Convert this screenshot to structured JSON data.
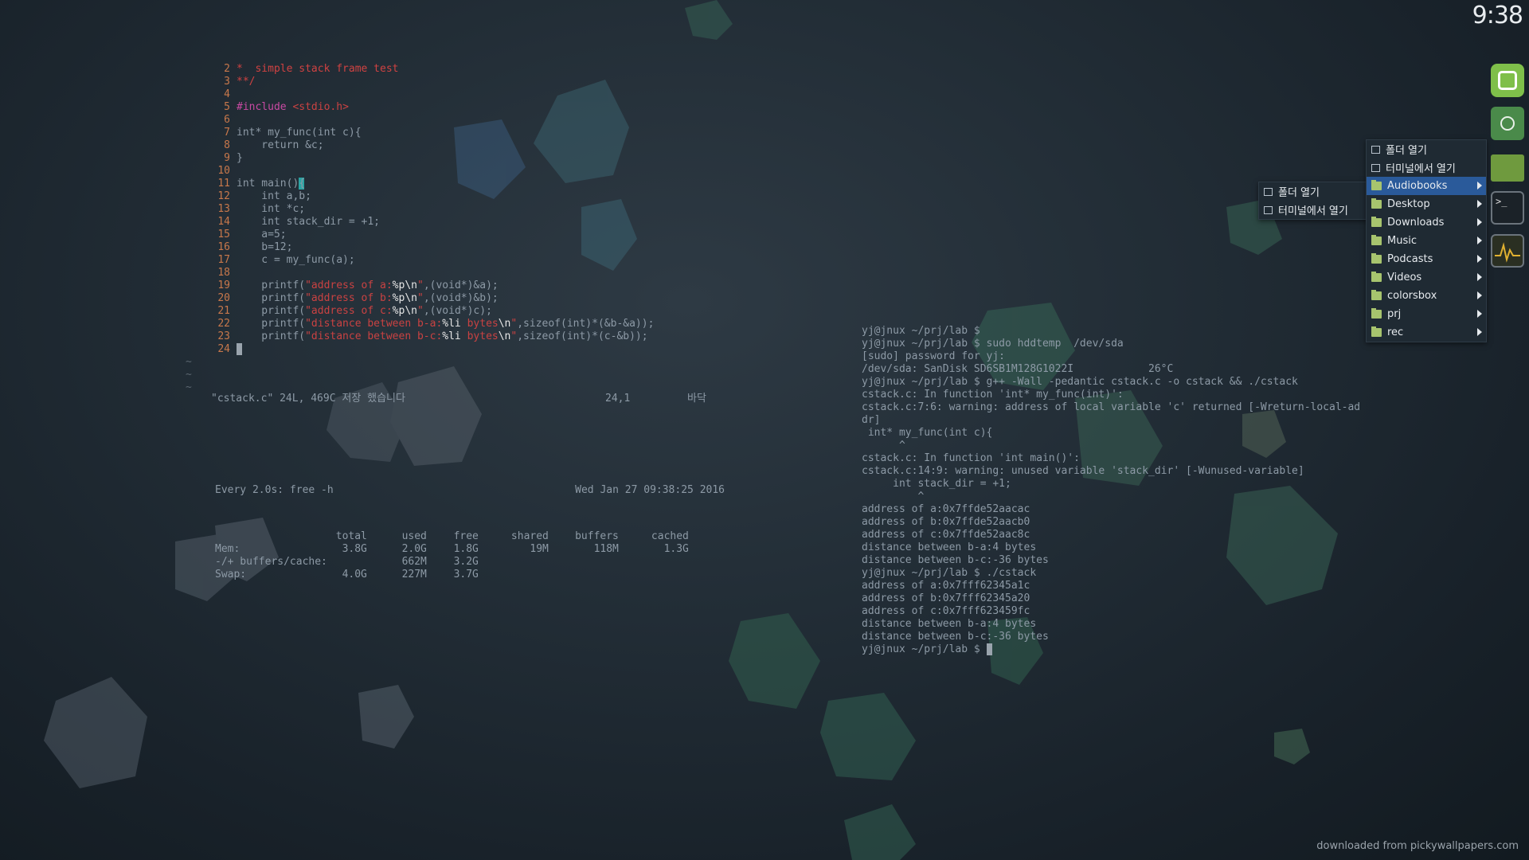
{
  "clock": "9:38",
  "vim": {
    "lines": [
      {
        "n": "2",
        "parts": [
          {
            "t": "*  simple stack frame test",
            "c": "red"
          }
        ]
      },
      {
        "n": "3",
        "parts": [
          {
            "t": "**/",
            "c": "red"
          }
        ]
      },
      {
        "n": "4",
        "parts": [
          {
            "t": "",
            "c": ""
          }
        ]
      },
      {
        "n": "5",
        "parts": [
          {
            "t": "#include ",
            "c": "pink"
          },
          {
            "t": "<stdio.h>",
            "c": "str"
          }
        ]
      },
      {
        "n": "6",
        "parts": [
          {
            "t": "",
            "c": ""
          }
        ]
      },
      {
        "n": "7",
        "parts": [
          {
            "t": "int* my_func(int c){",
            "c": ""
          }
        ]
      },
      {
        "n": "8",
        "parts": [
          {
            "t": "    return &c;",
            "c": ""
          }
        ]
      },
      {
        "n": "9",
        "parts": [
          {
            "t": "}",
            "c": ""
          }
        ]
      },
      {
        "n": "10",
        "parts": [
          {
            "t": "",
            "c": ""
          }
        ]
      },
      {
        "n": "11",
        "parts": [
          {
            "t": "int main()",
            "c": ""
          },
          {
            "t": "{",
            "c": "cursor"
          }
        ]
      },
      {
        "n": "12",
        "parts": [
          {
            "t": "    int a,b;",
            "c": ""
          }
        ]
      },
      {
        "n": "13",
        "parts": [
          {
            "t": "    int *c;",
            "c": ""
          }
        ]
      },
      {
        "n": "14",
        "parts": [
          {
            "t": "    int stack_dir = +1;",
            "c": ""
          }
        ]
      },
      {
        "n": "15",
        "parts": [
          {
            "t": "    a=5;",
            "c": ""
          }
        ]
      },
      {
        "n": "16",
        "parts": [
          {
            "t": "    b=12;",
            "c": ""
          }
        ]
      },
      {
        "n": "17",
        "parts": [
          {
            "t": "    c = my_func(a);",
            "c": ""
          }
        ]
      },
      {
        "n": "18",
        "parts": [
          {
            "t": "",
            "c": ""
          }
        ]
      },
      {
        "n": "19",
        "parts": [
          {
            "t": "    printf(",
            "c": ""
          },
          {
            "t": "\"address of a:",
            "c": "str"
          },
          {
            "t": "%p\\n",
            "c": "fmt"
          },
          {
            "t": "\"",
            "c": "str"
          },
          {
            "t": ",(void*)&a);",
            "c": ""
          }
        ]
      },
      {
        "n": "20",
        "parts": [
          {
            "t": "    printf(",
            "c": ""
          },
          {
            "t": "\"address of b:",
            "c": "str"
          },
          {
            "t": "%p\\n",
            "c": "fmt"
          },
          {
            "t": "\"",
            "c": "str"
          },
          {
            "t": ",(void*)&b);",
            "c": ""
          }
        ]
      },
      {
        "n": "21",
        "parts": [
          {
            "t": "    printf(",
            "c": ""
          },
          {
            "t": "\"address of c:",
            "c": "str"
          },
          {
            "t": "%p\\n",
            "c": "fmt"
          },
          {
            "t": "\"",
            "c": "str"
          },
          {
            "t": ",(void*)c);",
            "c": ""
          }
        ]
      },
      {
        "n": "22",
        "parts": [
          {
            "t": "    printf(",
            "c": ""
          },
          {
            "t": "\"distance between b-a:",
            "c": "str"
          },
          {
            "t": "%li ",
            "c": "fmt"
          },
          {
            "t": "bytes",
            "c": "str"
          },
          {
            "t": "\\n",
            "c": "fmt"
          },
          {
            "t": "\"",
            "c": "str"
          },
          {
            "t": ",sizeof(int)*(&b-&a));",
            "c": ""
          }
        ]
      },
      {
        "n": "23",
        "parts": [
          {
            "t": "    printf(",
            "c": ""
          },
          {
            "t": "\"distance between b-c:",
            "c": "str"
          },
          {
            "t": "%li ",
            "c": "fmt"
          },
          {
            "t": "bytes",
            "c": "str"
          },
          {
            "t": "\\n",
            "c": "fmt"
          },
          {
            "t": "\"",
            "c": "str"
          },
          {
            "t": ",sizeof(int)*(c-&b));",
            "c": ""
          }
        ]
      },
      {
        "n": "24",
        "parts": [
          {
            "t": " ",
            "c": "cursorgrey"
          }
        ]
      }
    ],
    "tildes": [
      "~",
      "~",
      "~"
    ],
    "status_msg": "\"cstack.c\" 24L, 469C 저장 했습니다",
    "status_pos": "24,1",
    "status_pct": "바닥"
  },
  "free": {
    "header_left": "Every 2.0s: free -h",
    "header_right": "Wed Jan 27 09:38:25 2016",
    "columns": [
      "",
      "total",
      "used",
      "free",
      "shared",
      "buffers",
      "cached"
    ],
    "rows": [
      [
        "Mem:",
        "3.8G",
        "2.0G",
        "1.8G",
        "19M",
        "118M",
        "1.3G"
      ],
      [
        "-/+ buffers/cache:",
        "",
        "662M",
        "3.2G",
        "",
        "",
        ""
      ],
      [
        "Swap:",
        "4.0G",
        "227M",
        "3.7G",
        "",
        "",
        ""
      ]
    ]
  },
  "terminal": {
    "lines": [
      "yj@jnux ~/prj/lab $",
      "yj@jnux ~/prj/lab $ sudo hddtemp  /dev/sda",
      "[sudo] password for yj:",
      "/dev/sda: SanDisk SD6SB1M128G1022I            26°C",
      "yj@jnux ~/prj/lab $ g++ -Wall -pedantic cstack.c -o cstack && ./cstack",
      "cstack.c: In function 'int* my_func(int)':",
      "cstack.c:7:6: warning: address of local variable 'c' returned [-Wreturn-local-ad",
      "dr]",
      " int* my_func(int c){",
      "      ^",
      "cstack.c: In function 'int main()':",
      "cstack.c:14:9: warning: unused variable 'stack_dir' [-Wunused-variable]",
      "     int stack_dir = +1;",
      "         ^",
      "address of a:0x7ffde52aacac",
      "address of b:0x7ffde52aacb0",
      "address of c:0x7ffde52aac8c",
      "distance between b-a:4 bytes",
      "distance between b-c:-36 bytes",
      "yj@jnux ~/prj/lab $ ./cstack",
      "address of a:0x7fff62345a1c",
      "address of b:0x7fff62345a20",
      "address of c:0x7fff623459fc",
      "distance between b-a:4 bytes",
      "distance between b-c:-36 bytes",
      "yj@jnux ~/prj/lab $ "
    ]
  },
  "menu_main": {
    "items": [
      {
        "label": "폴더 열기",
        "icon": "open-folder-icon",
        "kind": "action"
      },
      {
        "label": "터미널에서 열기",
        "icon": "terminal-icon",
        "kind": "action"
      },
      {
        "label": "Audiobooks",
        "icon": "folder-icon",
        "kind": "folder",
        "selected": true
      },
      {
        "label": "Desktop",
        "icon": "folder-icon",
        "kind": "folder"
      },
      {
        "label": "Downloads",
        "icon": "folder-icon",
        "kind": "folder"
      },
      {
        "label": "Music",
        "icon": "folder-icon",
        "kind": "folder"
      },
      {
        "label": "Podcasts",
        "icon": "folder-icon",
        "kind": "folder"
      },
      {
        "label": "Videos",
        "icon": "folder-icon",
        "kind": "folder"
      },
      {
        "label": "colorsbox",
        "icon": "folder-icon",
        "kind": "folder"
      },
      {
        "label": "prj",
        "icon": "folder-icon",
        "kind": "folder"
      },
      {
        "label": "rec",
        "icon": "folder-icon",
        "kind": "folder"
      }
    ]
  },
  "menu_sub": {
    "items": [
      {
        "label": "폴더 열기",
        "icon": "open-folder-icon"
      },
      {
        "label": "터미널에서 열기",
        "icon": "terminal-icon"
      }
    ]
  },
  "dock": [
    "mint-menu-icon",
    "compass-icon",
    "files-folder-icon",
    "terminal-app-icon",
    "system-monitor-icon"
  ],
  "watermark": "downloaded from pickywallpapers.com",
  "colors": {
    "selected": "#2a5a9a",
    "folder": "#a7c46e",
    "line_number": "#c8784b",
    "string": "#c94242"
  }
}
